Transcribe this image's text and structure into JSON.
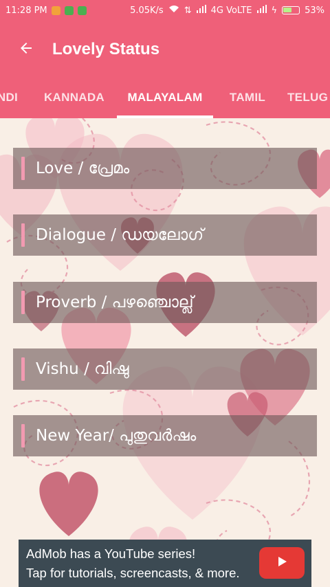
{
  "status_bar": {
    "time": "11:28 PM",
    "speed": "5.05K/s",
    "network": "4G VoLTE",
    "battery": "53%"
  },
  "app_bar": {
    "title": "Lovely Status"
  },
  "tabs": [
    {
      "label": "NDI"
    },
    {
      "label": "KANNADA"
    },
    {
      "label": "MALAYALAM",
      "active": true
    },
    {
      "label": "TAMIL"
    },
    {
      "label": "TELUG"
    }
  ],
  "categories": [
    {
      "label": "Love / പ്രേമം"
    },
    {
      "label": "Dialogue / ഡയലോഗ്"
    },
    {
      "label": "Proverb / പഴഞ്ചൊല്ല്"
    },
    {
      "label": "Vishu / വിഷു"
    },
    {
      "label": "New Year/ പുതുവർഷം"
    }
  ],
  "ad": {
    "line1": "AdMob has a YouTube series!",
    "line2": "Tap for tutorials, screencasts, & more."
  },
  "colors": {
    "primary": "#ef6079",
    "card_overlay": "#6e5858",
    "accent": "#f29ab1",
    "ad_bg": "#3c4a53",
    "play_red": "#e53935"
  }
}
